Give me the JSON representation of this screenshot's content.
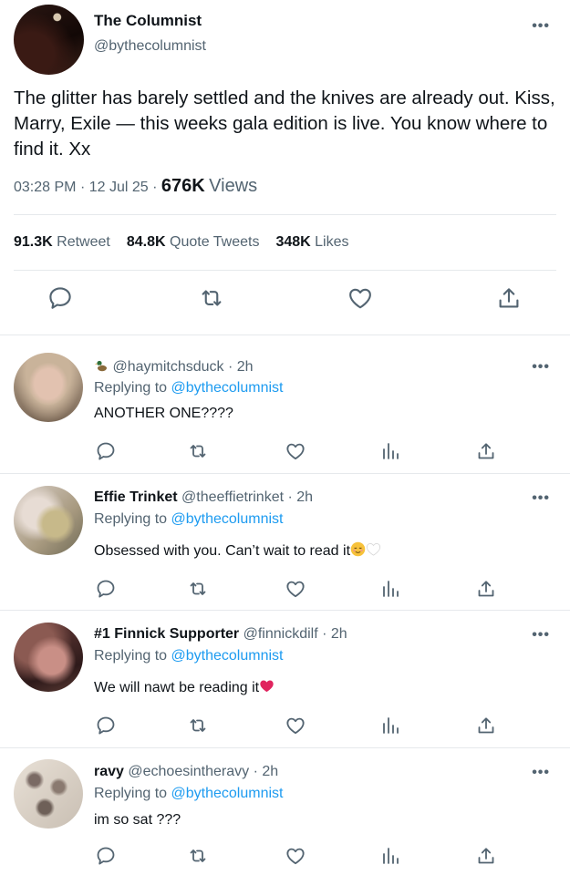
{
  "main": {
    "name": "The Columnist",
    "handle": "@bythecolumnist",
    "text": "The glitter has barely settled and the knives are already out. Kiss, Marry, Exile — this weeks gala edition is live. You know where to find it. Xx",
    "time": "03:28 PM",
    "date": "12 Jul 25",
    "views_count": "676K",
    "views_label": "Views",
    "retweets_count": "91.3K",
    "retweets_label": "Retweet",
    "quotes_count": "84.8K",
    "quotes_label": "Quote Tweets",
    "likes_count": "348K",
    "likes_label": "Likes"
  },
  "replies": [
    {
      "name": "",
      "handle": "@haymitchsduck",
      "age": "2h",
      "replying_label": "Replying to",
      "replying_to": "@bythecolumnist",
      "text": "ANOTHER ONE????",
      "name_icon": "duck-emoji"
    },
    {
      "name": "Effie Trinket",
      "handle": "@theeffietrinket",
      "age": "2h",
      "replying_label": "Replying to",
      "replying_to": "@bythecolumnist",
      "text": "Obsessed with you. Can’t wait to read it",
      "trailing_icons": [
        "relieved-face-emoji",
        "white-heart-emoji"
      ]
    },
    {
      "name": "#1 Finnick Supporter",
      "handle": "@finnickdilf",
      "age": "2h",
      "replying_label": "Replying to",
      "replying_to": "@bythecolumnist",
      "text": "We will nawt be reading it",
      "trailing_icons": [
        "red-heart-emoji"
      ]
    },
    {
      "name": "ravy",
      "handle": "@echoesintheravy",
      "age": "2h",
      "replying_label": "Replying to",
      "replying_to": "@bythecolumnist",
      "text": "im so sat ???"
    }
  ],
  "more_glyph": "•••",
  "sep_dot": "·",
  "colors": {
    "link": "#1d9bf0",
    "secondary": "#536471",
    "primary": "#0f1419",
    "divider": "#e6e9ec",
    "heart_red": "#e0245e"
  }
}
